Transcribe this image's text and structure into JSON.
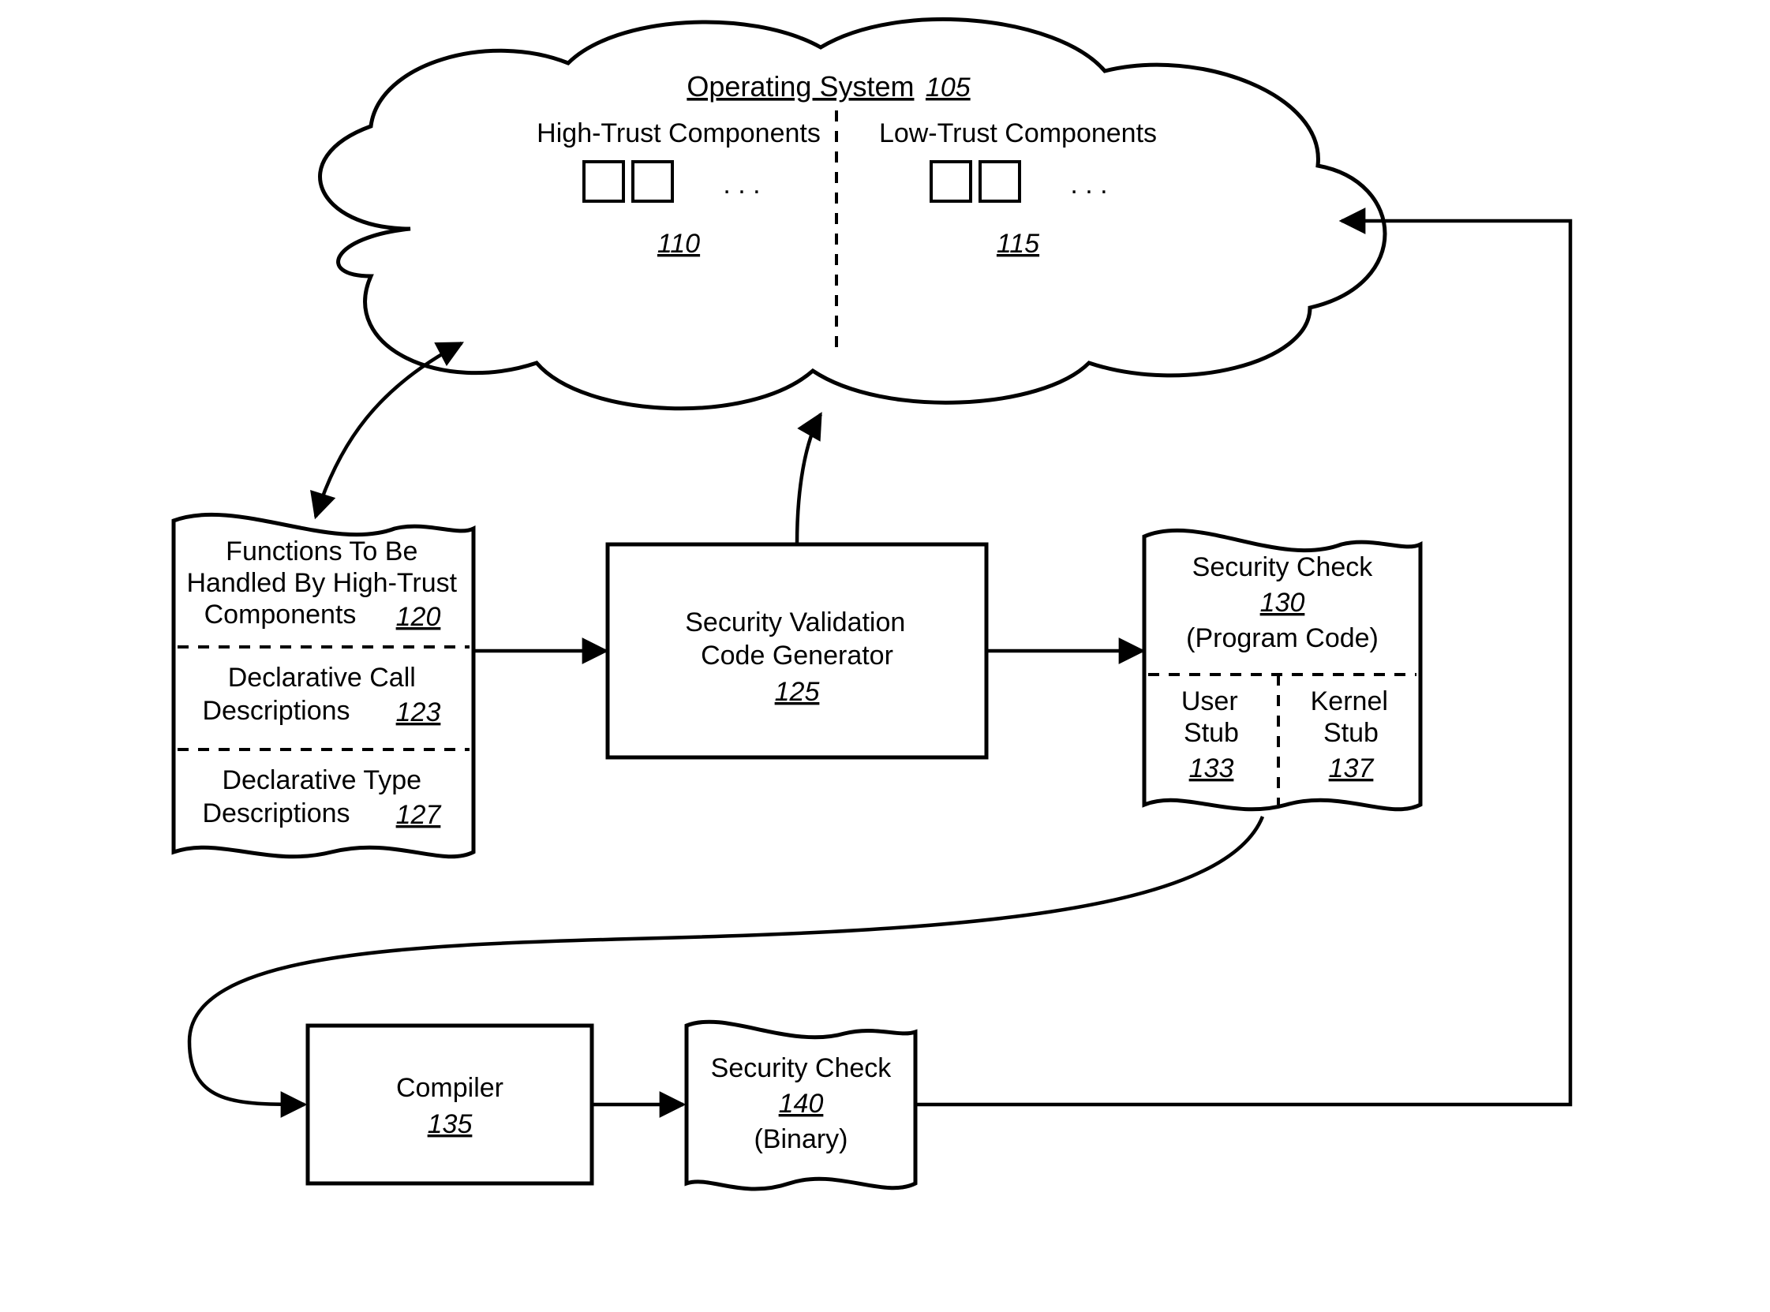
{
  "diagram": {
    "cloud": {
      "title": "Operating System",
      "title_num": "105",
      "left": {
        "heading": "High-Trust Components",
        "num": "110"
      },
      "right": {
        "heading": "Low-Trust Components",
        "num": "115"
      },
      "ellipsis": ". . ."
    },
    "doc_input": {
      "section1": {
        "l1": "Functions To Be",
        "l2": "Handled By High-Trust",
        "l3": "Components",
        "num": "120"
      },
      "section2": {
        "l1": "Declarative Call",
        "l2": "Descriptions",
        "num": "123"
      },
      "section3": {
        "l1": "Declarative Type",
        "l2": "Descriptions",
        "num": "127"
      }
    },
    "generator": {
      "l1": "Security Validation",
      "l2": "Code Generator",
      "num": "125"
    },
    "doc_output": {
      "top": {
        "l1": "Security Check",
        "num": "130",
        "l2": "(Program Code)"
      },
      "left": {
        "l1": "User",
        "l2": "Stub",
        "num": "133"
      },
      "right": {
        "l1": "Kernel",
        "l2": "Stub",
        "num": "137"
      }
    },
    "compiler": {
      "label": "Compiler",
      "num": "135"
    },
    "binary": {
      "l1": "Security Check",
      "num": "140",
      "l2": "(Binary)"
    }
  }
}
